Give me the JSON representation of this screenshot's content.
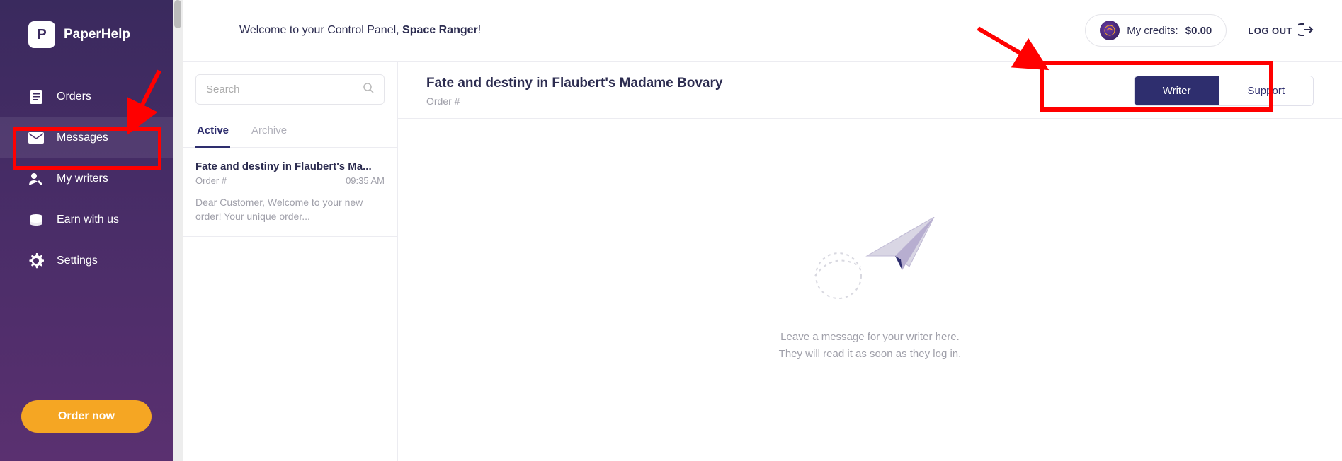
{
  "brand": {
    "letter": "P",
    "name": "PaperHelp"
  },
  "sidebar": {
    "items": [
      {
        "label": "Orders"
      },
      {
        "label": "Messages"
      },
      {
        "label": "My writers"
      },
      {
        "label": "Earn with us"
      },
      {
        "label": "Settings"
      }
    ],
    "order_now": "Order now"
  },
  "topbar": {
    "welcome_prefix": "Welcome to your Control Panel, ",
    "user_name": "Space Ranger",
    "welcome_suffix": "!",
    "credits_label": "My credits: ",
    "credits_value": "$0.00",
    "logout": "LOG OUT"
  },
  "search": {
    "placeholder": "Search"
  },
  "tabs": {
    "active": "Active",
    "archive": "Archive"
  },
  "conversation": {
    "title": "Fate and destiny in Flaubert's Ma...",
    "order_label": "Order #",
    "order_num": "",
    "time": "09:35 AM",
    "preview": "Dear Customer, Welcome to your new order! Your unique order..."
  },
  "detail": {
    "title": "Fate and destiny in Flaubert's Madame Bovary",
    "order_label": "Order #",
    "order_num": "",
    "seg_writer": "Writer",
    "seg_support": "Support",
    "empty_line1": "Leave a message for your writer here.",
    "empty_line2": "They will read it as soon as they log in."
  }
}
